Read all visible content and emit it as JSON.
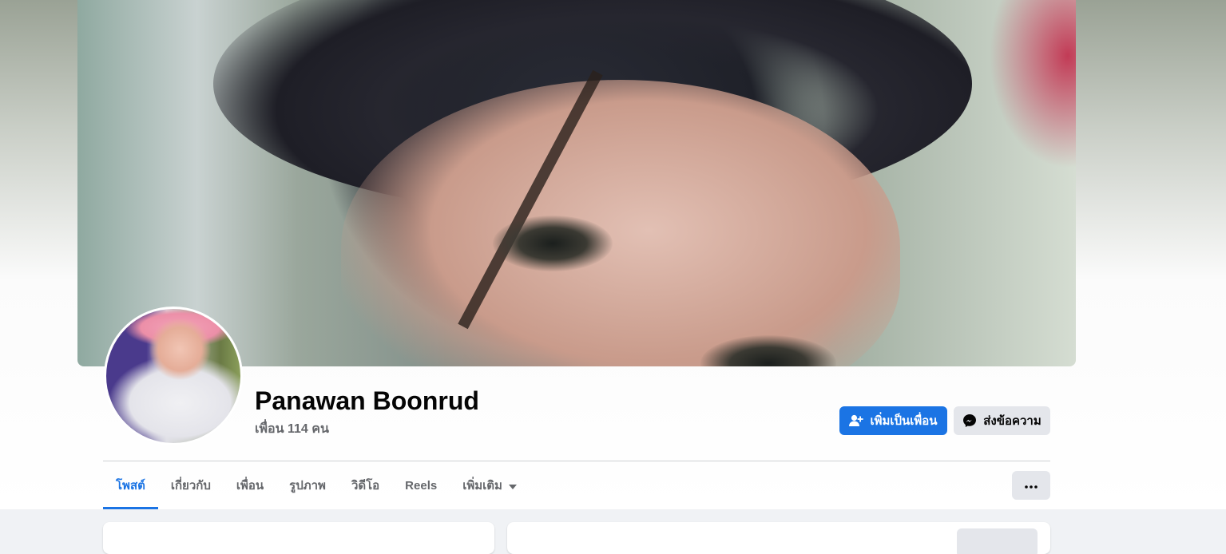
{
  "profile": {
    "name": "Panawan Boonrud",
    "friends_count_text": "เพื่อน 114 คน"
  },
  "actions": {
    "add_friend_label": "เพิ่มเป็นเพื่อน",
    "add_friend_icon": "add-friend-icon",
    "message_label": "ส่งข้อความ",
    "message_icon": "messenger-icon",
    "more_icon": "ellipsis-icon"
  },
  "tabs": [
    {
      "label": "โพสต์",
      "active": true
    },
    {
      "label": "เกี่ยวกับ",
      "active": false
    },
    {
      "label": "เพื่อน",
      "active": false
    },
    {
      "label": "รูปภาพ",
      "active": false
    },
    {
      "label": "วิดีโอ",
      "active": false
    },
    {
      "label": "Reels",
      "active": false
    },
    {
      "label": "เพิ่มเติม",
      "active": false,
      "dropdown": true
    }
  ],
  "colors": {
    "accent": "#1b74e4",
    "secondary_button": "#e4e6eb",
    "muted_text": "#65676b",
    "page_background": "#f0f2f5"
  }
}
